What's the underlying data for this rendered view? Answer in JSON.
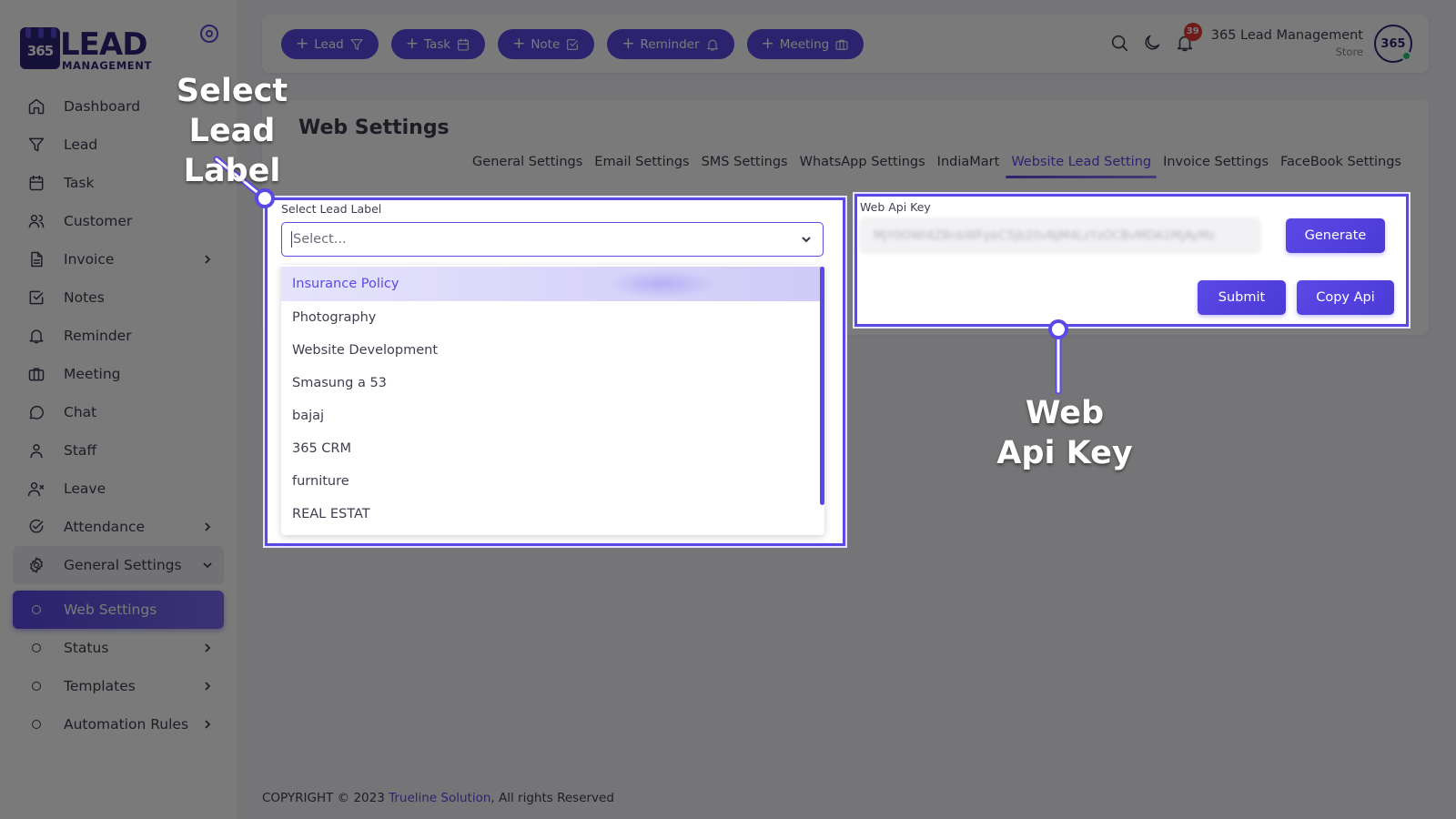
{
  "brand": {
    "logo_number": "365",
    "logo_word": "LEAD",
    "logo_sub": "MANAGEMENT"
  },
  "sidebar": {
    "items": [
      {
        "label": "Dashboard",
        "icon": "home-icon",
        "has_chevron": false
      },
      {
        "label": "Lead",
        "icon": "filter-icon",
        "has_chevron": false
      },
      {
        "label": "Task",
        "icon": "calendar-icon",
        "has_chevron": false
      },
      {
        "label": "Customer",
        "icon": "users-icon",
        "has_chevron": false
      },
      {
        "label": "Invoice",
        "icon": "file-text-icon",
        "has_chevron": true
      },
      {
        "label": "Notes",
        "icon": "check-square-icon",
        "has_chevron": false
      },
      {
        "label": "Reminder",
        "icon": "bell-icon",
        "has_chevron": false
      },
      {
        "label": "Meeting",
        "icon": "briefcase-icon",
        "has_chevron": false
      },
      {
        "label": "Chat",
        "icon": "message-circle-icon",
        "has_chevron": false
      },
      {
        "label": "Staff",
        "icon": "user-icon",
        "has_chevron": false
      },
      {
        "label": "Leave",
        "icon": "user-x-icon",
        "has_chevron": false
      },
      {
        "label": "Attendance",
        "icon": "check-circle-icon",
        "has_chevron": true
      },
      {
        "label": "General Settings",
        "icon": "gear-icon",
        "has_chevron": true,
        "expanded": true
      }
    ],
    "sub_items": [
      {
        "label": "Web Settings",
        "active": true,
        "has_chevron": false
      },
      {
        "label": "Status",
        "active": false,
        "has_chevron": true
      },
      {
        "label": "Templates",
        "active": false,
        "has_chevron": true
      },
      {
        "label": "Automation Rules",
        "active": false,
        "has_chevron": true
      }
    ]
  },
  "topbar": {
    "quick_actions": [
      {
        "label": "Lead",
        "icon": "filter-icon"
      },
      {
        "label": "Task",
        "icon": "calendar-icon"
      },
      {
        "label": "Note",
        "icon": "check-square-icon"
      },
      {
        "label": "Reminder",
        "icon": "bell-icon"
      },
      {
        "label": "Meeting",
        "icon": "briefcase-icon"
      }
    ],
    "plus_glyph": "+",
    "notification_count": "39",
    "user_name": "365 Lead Management",
    "user_role": "Store",
    "avatar_text": "365"
  },
  "page": {
    "title": "Web Settings",
    "tabs": [
      {
        "label": "General Settings",
        "active": false
      },
      {
        "label": "Email Settings",
        "active": false
      },
      {
        "label": "SMS Settings",
        "active": false
      },
      {
        "label": "WhatsApp Settings",
        "active": false
      },
      {
        "label": "IndiaMart",
        "active": false
      },
      {
        "label": "Website Lead Setting",
        "active": true
      },
      {
        "label": "Invoice Settings",
        "active": false
      },
      {
        "label": "FaceBook Settings",
        "active": false
      }
    ]
  },
  "lead_label": {
    "label": "Select Lead Label",
    "placeholder": "Select...",
    "options": [
      "Insurance Policy",
      "Photography",
      "Website Development",
      "Smasung a 53",
      "bajaj",
      "365 CRM",
      "furniture",
      "REAL ESTAT"
    ],
    "highlighted_index": 0
  },
  "web_api": {
    "label": "Web Api Key",
    "value": "MjY0OWI4ZBnbWFpbC5jb20vNjM4LzYzOCBvMDA1MjAyMz",
    "generate_label": "Generate",
    "submit_label": "Submit",
    "copy_label": "Copy Api"
  },
  "annotations": {
    "left_line1": "Select",
    "left_line2": "Lead Label",
    "right_line1": "Web",
    "right_line2": "Api Key"
  },
  "footer": {
    "prefix": "COPYRIGHT © 2023 ",
    "link": "Trueline Solution",
    "suffix": ", All rights Reserved"
  },
  "colors": {
    "accent": "#5b49e6",
    "brand_dark": "#2e2477",
    "badge": "#e53935",
    "online": "#28c76f"
  }
}
